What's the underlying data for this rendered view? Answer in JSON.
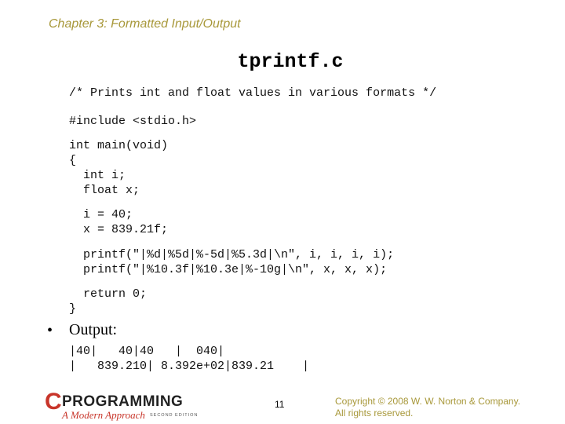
{
  "header": {
    "chapter": "Chapter 3: Formatted Input/Output"
  },
  "slide": {
    "title": "tprintf.c",
    "code_blocks": [
      "/* Prints int and float values in various formats */",
      "#include <stdio.h>",
      "int main(void)\n{\n  int i;\n  float x;",
      "  i = 40;\n  x = 839.21f;",
      "  printf(\"|%d|%5d|%-5d|%5.3d|\\n\", i, i, i, i);\n  printf(\"|%10.3f|%10.3e|%-10g|\\n\", x, x, x);",
      "  return 0;\n}"
    ],
    "bullet_char": "•",
    "bullet_label": "Output:",
    "output_block": "|40|   40|40   |  040|\n|   839.210| 8.392e+02|839.21    |"
  },
  "footer": {
    "logo": {
      "letter": "C",
      "word": "PROGRAMMING",
      "subtitle": "A Modern Approach",
      "edition": "SECOND EDITION"
    },
    "page_number": "11",
    "copyright_line1": "Copyright © 2008 W. W. Norton & Company.",
    "copyright_line2": "All rights reserved."
  },
  "colors": {
    "accent_gold": "#a8983a",
    "logo_red": "#c8352a"
  }
}
